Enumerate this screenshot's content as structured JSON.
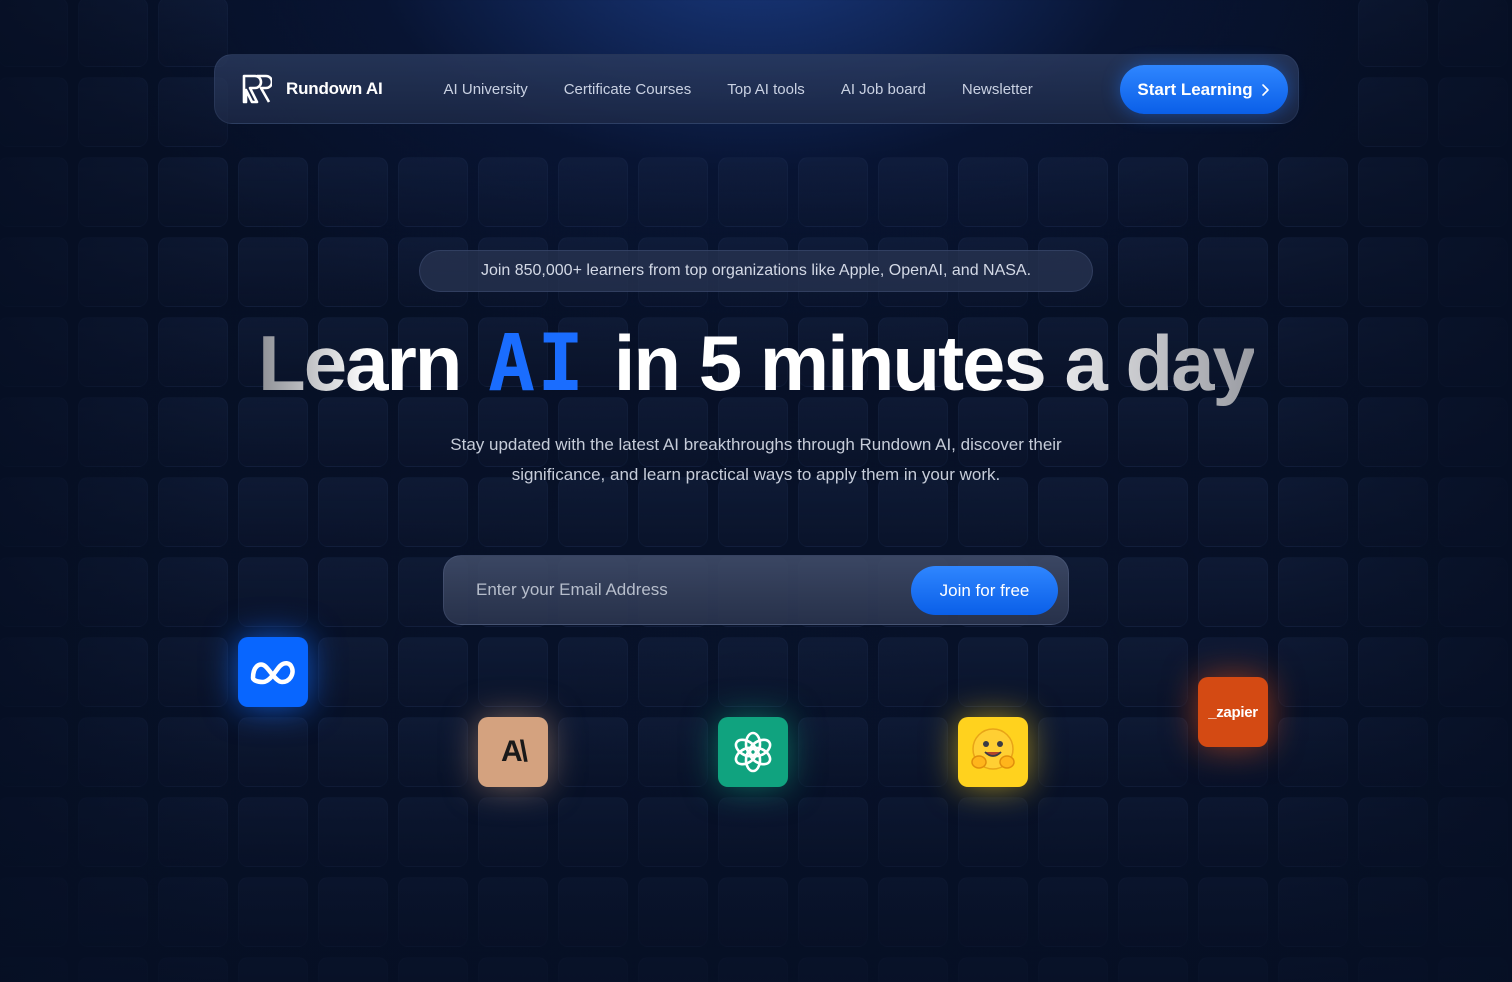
{
  "brand": {
    "name": "Rundown AI",
    "logo_icon": "rundown-logo-icon"
  },
  "nav": {
    "links": [
      "AI University",
      "Certificate Courses",
      "Top AI tools",
      "AI Job board",
      "Newsletter"
    ],
    "cta_label": "Start Learning",
    "cta_icon": "chevron-right-icon"
  },
  "hero": {
    "pill_text": "Join 850,000+ learners from top organizations like Apple, OpenAI, and NASA.",
    "headline_part1": "Learn",
    "headline_highlight": "AI",
    "headline_part2": "in 5 minutes a day",
    "subtext": "Stay updated with the latest AI breakthroughs through Rundown AI, discover their significance, and learn practical ways to apply them in your work."
  },
  "signup": {
    "email_placeholder": "Enter your Email Address",
    "email_value": "",
    "submit_label": "Join for free"
  },
  "logos": {
    "meta": {
      "icon": "meta-logo-icon",
      "color": "#0866ff"
    },
    "anthropic": {
      "icon": "anthropic-logo-icon",
      "text": "A\\",
      "color": "#d4a27f"
    },
    "openai": {
      "icon": "openai-logo-icon",
      "color": "#10a37f"
    },
    "huggingface": {
      "icon": "huggingface-logo-icon",
      "text": "🤗",
      "color": "#ffd21e"
    },
    "zapier": {
      "icon": "zapier-logo-icon",
      "text": "_zapier",
      "color": "#d44a13"
    }
  },
  "colors": {
    "accent": "#1a6dff",
    "background": "#060f24"
  }
}
